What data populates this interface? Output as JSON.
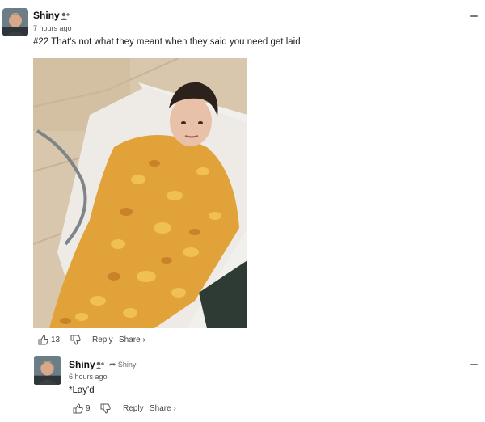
{
  "main_comment": {
    "author": "Shiny",
    "time": "7 hours ago",
    "text": "#22 That's not what they meant when they said you need get laid",
    "upvotes": "13",
    "reply_label": "Reply",
    "share_label": "Share ›"
  },
  "reply_comment": {
    "author": "Shiny",
    "reply_to": "Shiny",
    "time": "6 hours ago",
    "text": "*Lay'd",
    "upvotes": "9",
    "reply_label": "Reply",
    "share_label": "Share ›"
  },
  "icons": [
    "avatar",
    "follow-icon",
    "more-options-icon",
    "thumbs-up-icon",
    "thumbs-down-icon",
    "reply-arrow-icon"
  ],
  "colors": {
    "text": "#222222",
    "muted": "#555555",
    "chips": "#e0a43a"
  }
}
